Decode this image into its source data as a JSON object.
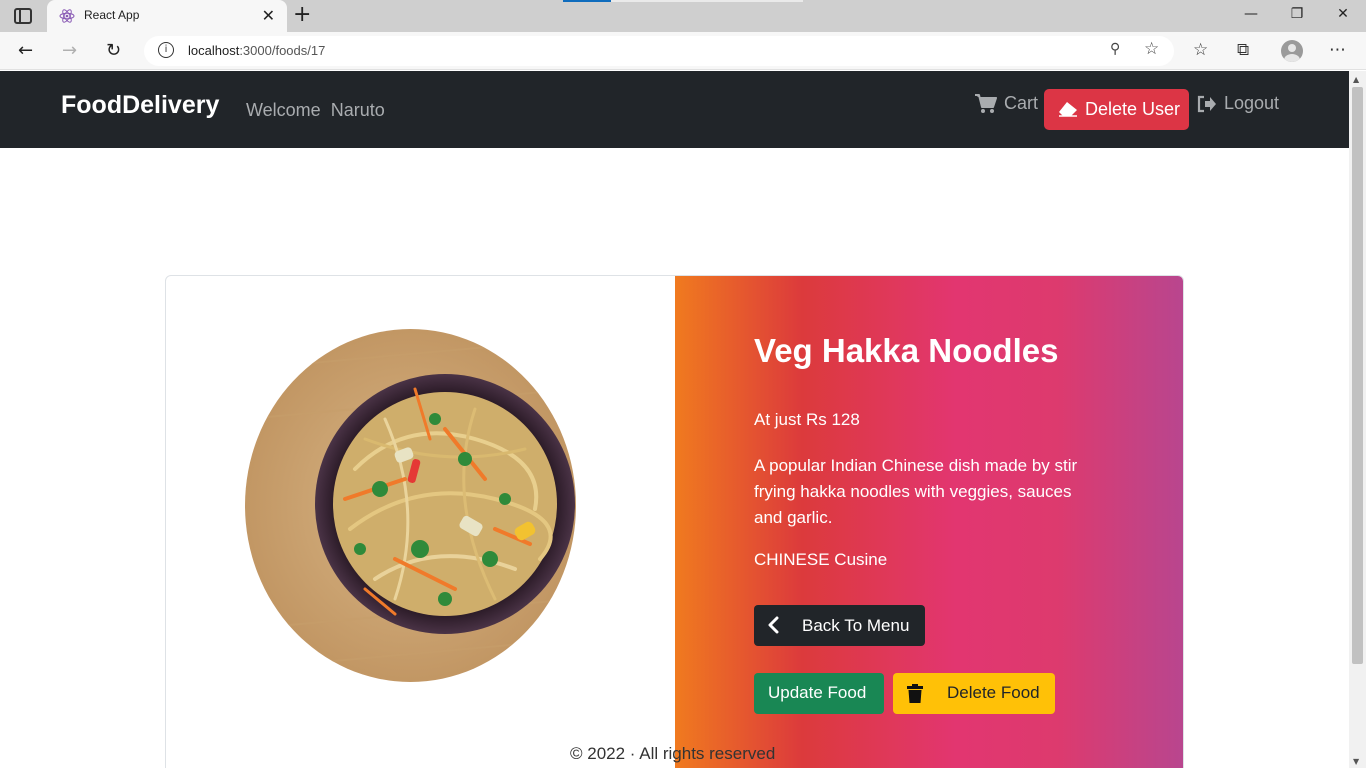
{
  "browser": {
    "tab_title": "React App",
    "url_host": "localhost",
    "url_path": ":3000/foods/17",
    "new_tab_glyph": "+",
    "close_tab_glyph": "✕",
    "icons": [
      "tab-actions-icon",
      "react-favicon",
      "back-icon",
      "forward-icon",
      "refresh-icon",
      "info-icon",
      "zoom-icon",
      "add-favorite-icon",
      "favorites-icon",
      "collections-icon",
      "profile-icon",
      "more-icon",
      "minimize-icon",
      "restore-icon",
      "close-window-icon"
    ]
  },
  "navbar": {
    "brand": "FoodDelivery",
    "welcome": "Welcome  Naruto",
    "cart_label": "Cart",
    "delete_user_label": "Delete User",
    "logout_label": "Logout",
    "colors": {
      "background": "#212529",
      "danger": "#dc3545",
      "muted": "#a9acaf"
    }
  },
  "food": {
    "name": "Veg Hakka Noodles",
    "price_text": "At just Rs 128",
    "description": "A popular Indian Chinese dish made by stir frying hakka noodles with veggies, sauces and garlic.",
    "cuisine_text": "CHINESE Cusine",
    "image_alt": "noodles-bowl-photo"
  },
  "actions": {
    "back_label": "Back To Menu",
    "update_label": "Update Food",
    "delete_label": "Delete Food",
    "colors": {
      "back": "#212529",
      "update": "#198754",
      "delete": "#ffc107"
    }
  },
  "footer": {
    "text": "© 2022 · All rights reserved"
  }
}
